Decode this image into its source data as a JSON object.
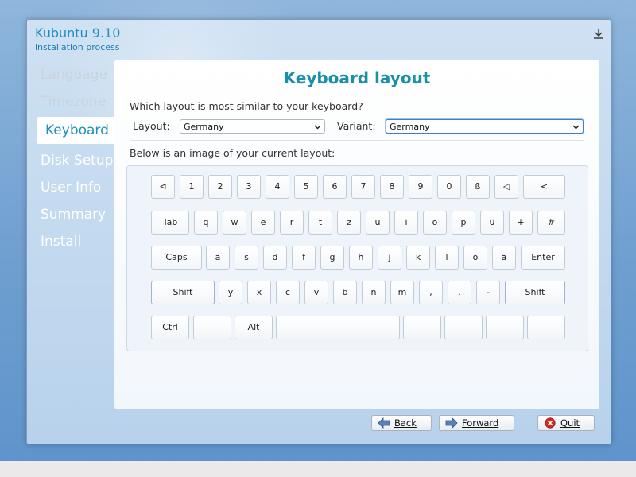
{
  "app": {
    "title": "Kubuntu 9.10",
    "subtitle": "installation process"
  },
  "nav": {
    "items": [
      {
        "label": "Language",
        "state": "done"
      },
      {
        "label": "Timezone",
        "state": "done"
      },
      {
        "label": "Keyboard",
        "state": "active"
      },
      {
        "label": "Disk Setup",
        "state": "todo"
      },
      {
        "label": "User Info",
        "state": "todo"
      },
      {
        "label": "Summary",
        "state": "todo"
      },
      {
        "label": "Install",
        "state": "todo"
      }
    ]
  },
  "page": {
    "title": "Keyboard layout",
    "question": "Which layout is most similar to your keyboard?",
    "layout_label": "Layout:",
    "layout_value": "Germany",
    "variant_label": "Variant:",
    "variant_value": "Germany",
    "image_caption": "Below is an image of your current layout:"
  },
  "keyboard": {
    "row1": [
      "⊲",
      "1",
      "2",
      "3",
      "4",
      "5",
      "6",
      "7",
      "8",
      "9",
      "0",
      "ß",
      "◁",
      "<"
    ],
    "row2": [
      "Tab",
      "q",
      "w",
      "e",
      "r",
      "t",
      "z",
      "u",
      "i",
      "o",
      "p",
      "ü",
      "+",
      "#"
    ],
    "row3": [
      "Caps",
      "a",
      "s",
      "d",
      "f",
      "g",
      "h",
      "j",
      "k",
      "l",
      "ö",
      "ä",
      "Enter"
    ],
    "row4": [
      "Shift",
      "y",
      "x",
      "c",
      "v",
      "b",
      "n",
      "m",
      ",",
      ".",
      "-",
      "Shift"
    ],
    "row5": [
      "Ctrl",
      "",
      "Alt",
      "",
      "",
      "",
      "",
      ""
    ]
  },
  "buttons": {
    "back_label": "Back",
    "forward_label": "Forward",
    "quit_label": "Quit"
  },
  "colors": {
    "accent": "#1a8fc2",
    "quit_icon": "#d42b1e",
    "arrow_icon": "#4a6fa5"
  },
  "icons": [
    "download-icon",
    "chevron-down-icon",
    "back-arrow-icon",
    "forward-arrow-icon",
    "quit-icon"
  ]
}
